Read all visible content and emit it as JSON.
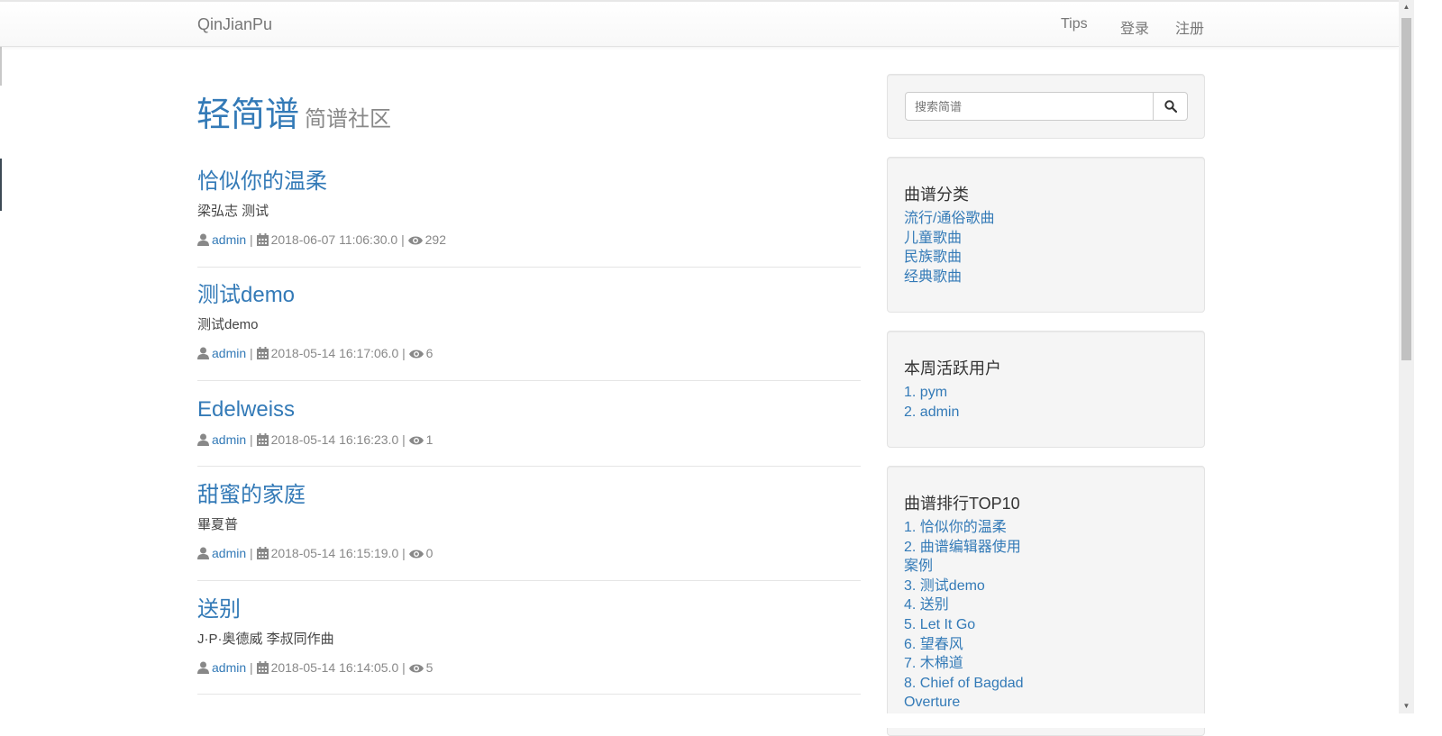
{
  "navbar": {
    "brand": "QinJianPu",
    "links": {
      "tips": "Tips",
      "login": "登录",
      "register": "注册"
    }
  },
  "header": {
    "title": "轻简谱",
    "subtitle": "简谱社区"
  },
  "posts": [
    {
      "title": "恰似你的温柔",
      "subtitle": "梁弘志 测试",
      "author": "admin",
      "date": "2018-06-07 11:06:30.0",
      "views": "292"
    },
    {
      "title": "测试demo",
      "subtitle": "测试demo",
      "author": "admin",
      "date": "2018-05-14 16:17:06.0",
      "views": "6"
    },
    {
      "title": "Edelweiss",
      "subtitle": "",
      "author": "admin",
      "date": "2018-05-14 16:16:23.0",
      "views": "1"
    },
    {
      "title": "甜蜜的家庭",
      "subtitle": "畢夏普",
      "author": "admin",
      "date": "2018-05-14 16:15:19.0",
      "views": "0"
    },
    {
      "title": "送别",
      "subtitle": "J·P·奥德威 李叔同作曲",
      "author": "admin",
      "date": "2018-05-14 16:14:05.0",
      "views": "5"
    }
  ],
  "sidebar": {
    "search": {
      "placeholder": "搜索简谱"
    },
    "categories": {
      "title": "曲谱分类",
      "items": [
        "流行/通俗歌曲",
        "儿童歌曲",
        "民族歌曲",
        "经典歌曲"
      ]
    },
    "active_users": {
      "title": "本周活跃用户",
      "items": [
        "1. pym",
        "2. admin"
      ]
    },
    "top10": {
      "title": "曲谱排行TOP10",
      "items": [
        "1. 恰似你的温柔",
        "2. 曲谱编辑器使用案例",
        "3. 测试demo",
        "4. 送别",
        "5. Let It Go",
        "6. 望春风",
        "7. 木棉道",
        "8. Chief of Bagdad Overture"
      ]
    }
  },
  "meta_separator": "|",
  "colors": {
    "link": "#337ab7",
    "muted": "#888888",
    "well_bg": "#f5f5f5"
  },
  "icons": {
    "author": "user-icon",
    "date": "calendar-icon",
    "views": "eye-icon",
    "search": "search-icon"
  }
}
